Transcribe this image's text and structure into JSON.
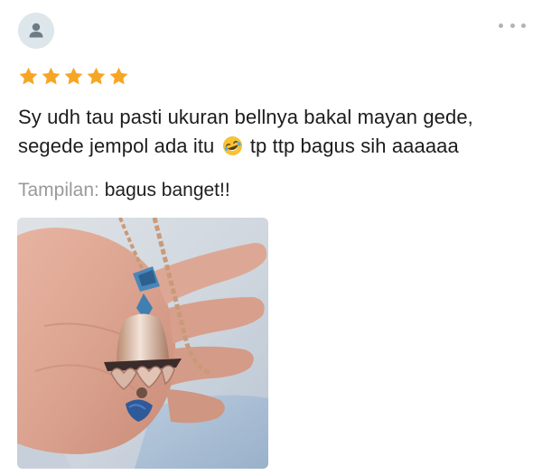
{
  "review": {
    "avatar_icon": "user-silhouette-icon",
    "more_icon": "more-horizontal-icon",
    "rating": 5,
    "rating_max": 5,
    "star_color": "#f6a623",
    "text_line1": "Sy udh tau pasti ukuran bellnya bakal mayan gede,",
    "text_line2_before": "segede jempol ada itu",
    "text_emoji": "rolling-on-floor-laughing-emoji",
    "text_line2_after": "tp ttp bagus sih aaaaaa",
    "attribute_label": "Tampilan:",
    "attribute_value": "bagus banget!!",
    "photo_subject": "hand-holding-bell-pendant-necklace"
  }
}
